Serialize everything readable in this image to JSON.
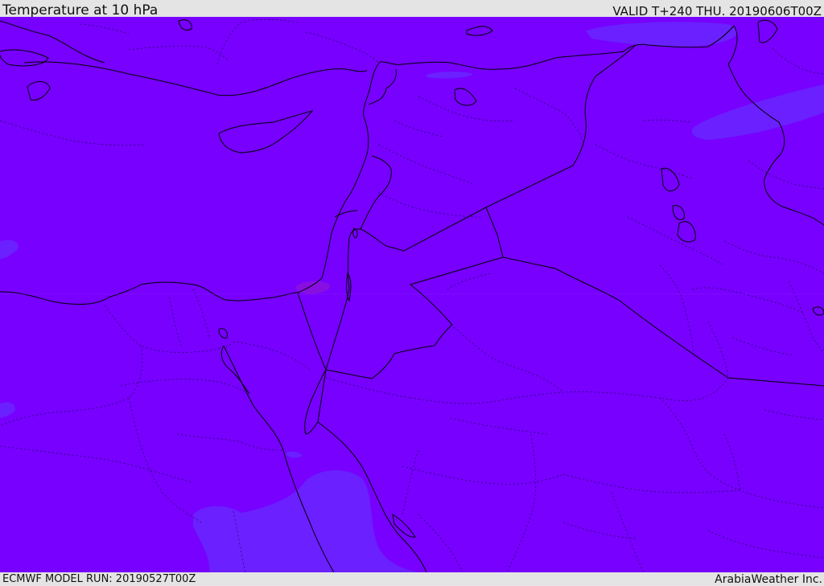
{
  "header": {
    "title": "Temperature at 10 hPa",
    "valid_time": "VALID T+240 THU. 20190606T00Z"
  },
  "footer": {
    "model_run": "ECMWF MODEL RUN: 20190527T00Z",
    "credit": "ArabiaWeather Inc."
  },
  "map": {
    "colors": {
      "field_base": "#7700ff",
      "field_cooler_patch": "#6a22ff",
      "field_warmer_patch": "#8810e0",
      "boundary_solid": "#000000",
      "boundary_dotted": "#1a0840"
    }
  }
}
